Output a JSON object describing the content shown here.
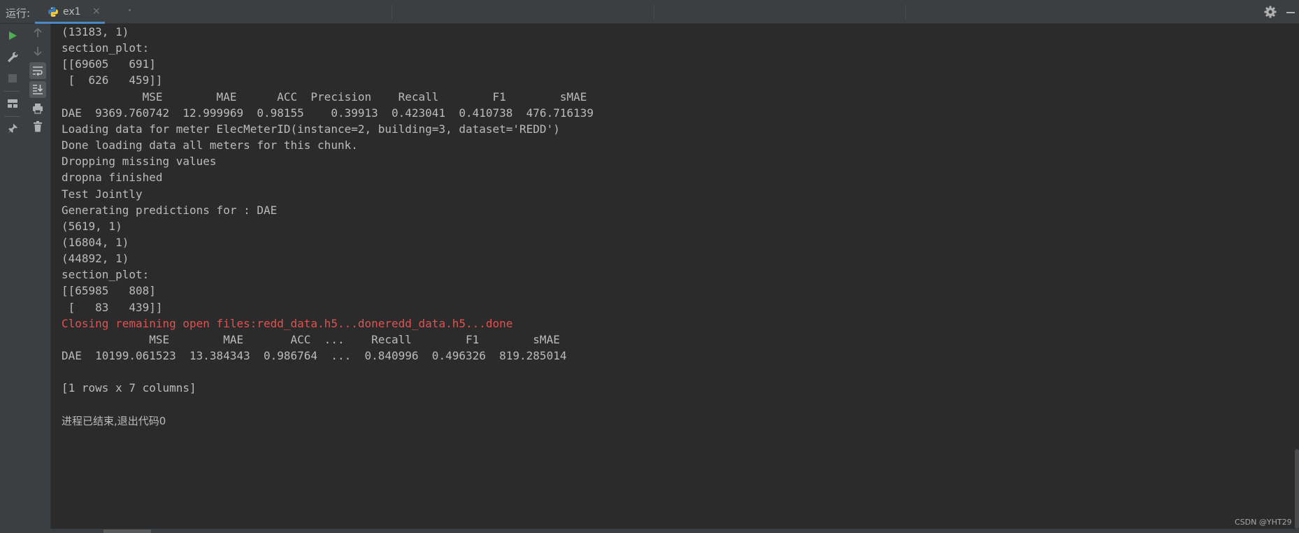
{
  "run_panel": {
    "label": "运行:",
    "tab": {
      "title": "ex1",
      "close": "×"
    }
  },
  "icons": {
    "run": "run-icon",
    "wrench": "wrench-icon",
    "stop": "stop-icon",
    "layout": "layout-icon",
    "pin": "pin-icon",
    "up": "arrow-up-icon",
    "down": "arrow-down-icon",
    "soft_wrap": "soft-wrap-icon",
    "scroll_end": "scroll-to-end-icon",
    "print": "print-icon",
    "trash": "trash-icon",
    "gear": "gear-icon",
    "python": "python-icon"
  },
  "colors": {
    "run_green": "#4caf50",
    "accent_blue": "#4a88c7",
    "error_red": "#e05252"
  },
  "console": {
    "lines": [
      "(13183, 1)",
      "section_plot:",
      "[[69605   691]",
      " [  626   459]]",
      "            MSE        MAE      ACC  Precision    Recall        F1        sMAE",
      "DAE  9369.760742  12.999969  0.98155    0.39913  0.423041  0.410738  476.716139",
      "Loading data for meter ElecMeterID(instance=2, building=3, dataset='REDD')",
      "Done loading data all meters for this chunk.",
      "Dropping missing values",
      "dropna finished",
      "Test Jointly",
      "Generating predictions for : DAE",
      "(5619, 1)",
      "(16804, 1)",
      "(44892, 1)",
      "section_plot:",
      "[[65985   808]",
      " [   83   439]]",
      "Closing remaining open files:redd_data.h5...doneredd_data.h5...done",
      "             MSE        MAE       ACC  ...    Recall        F1        sMAE",
      "DAE  10199.061523  13.384343  0.986764  ...  0.840996  0.496326  819.285014",
      "",
      "[1 rows x 7 columns]",
      "",
      "进程已结束,退出代码0"
    ],
    "error_line_index": 18
  },
  "watermark": "CSDN @YHT29"
}
